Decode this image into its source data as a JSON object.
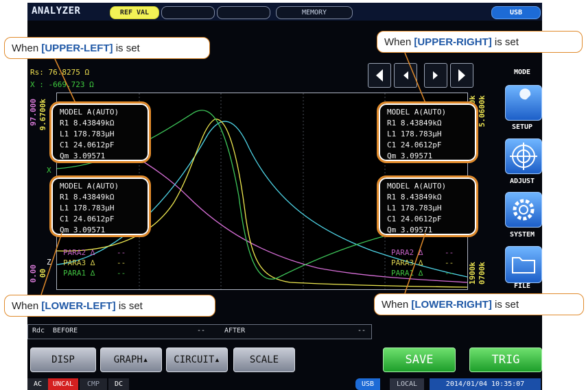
{
  "header": {
    "title": "ANALYZER",
    "ref_val": "REF VAL",
    "memory": "MEMORY",
    "usb": "USB"
  },
  "readouts": {
    "rs": "Rs: 76.8275 Ω",
    "x": "X : -669.723 Ω",
    "rs_color": "#f0e050",
    "x_color": "#40d040"
  },
  "axis": {
    "left_top_1": "97.000",
    "left_top_2": "9.6700k",
    "left_bottom_1": "0.00",
    "left_bottom_2": "00",
    "right_top_1": "9.7000k",
    "right_top_2": "5.0600k",
    "right_bottom_1": "1900k",
    "right_bottom_2": "0700k",
    "x_marker": "X",
    "z_marker": "Z"
  },
  "side_menu": {
    "mode": "MODE",
    "setup": "SETUP",
    "adjust": "ADJUST",
    "system": "SYSTEM",
    "file": "FILE"
  },
  "model_box": {
    "title": "MODEL A(AUTO)",
    "r1": "R1 8.43849kΩ",
    "l1": "L1 178.783µH",
    "c1": "C1 24.0612pF",
    "qm": "Qm 3.09571"
  },
  "callouts": {
    "upper_left_pre": "When ",
    "upper_left_key": "[UPPER-LEFT]",
    "upper_left_post": " is set",
    "upper_right_pre": "When ",
    "upper_right_key": "[UPPER-RIGHT]",
    "upper_right_post": " is set",
    "lower_left_pre": "When ",
    "lower_left_key": "[LOWER-LEFT]",
    "lower_left_post": " is set",
    "lower_right_pre": "When ",
    "lower_right_key": "[LOWER-RIGHT]",
    "lower_right_post": " is set"
  },
  "params": {
    "para2": "PARA2",
    "para3": "PARA3",
    "para1": "PARA1",
    "delta": "∆",
    "dash": "--"
  },
  "rdc_row": {
    "rdc": "Rdc",
    "before": "BEFORE",
    "before_val": "--",
    "after": "AFTER",
    "after_val": "--"
  },
  "buttons": {
    "disp": "DISP",
    "graph": "GRAPH▴",
    "circuit": "CIRCUIT▴",
    "scale": "SCALE",
    "save": "SAVE",
    "trig": "TRIG"
  },
  "status": {
    "ac": "AC",
    "uncal": "UNCAL",
    "cmp": "CMP",
    "dc": "DC",
    "usb": "USB",
    "local": "LOCAL",
    "datetime": "2014/01/04 10:35:07"
  }
}
